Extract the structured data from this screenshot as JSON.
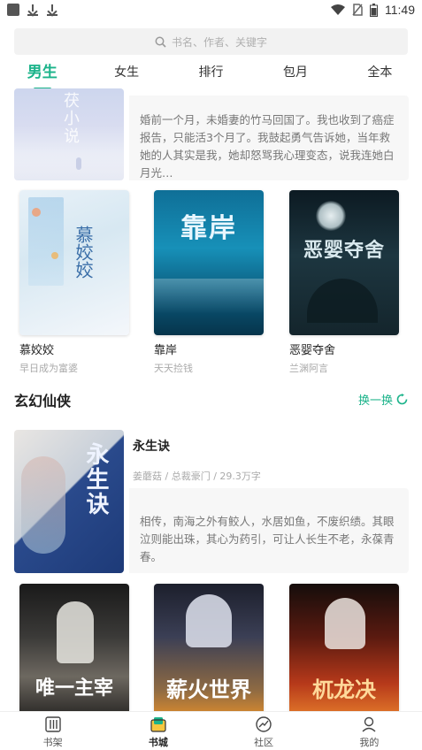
{
  "status_bar": {
    "time": "11:49"
  },
  "search": {
    "placeholder": "书名、作者、关键字"
  },
  "tabs": [
    {
      "label": "男生",
      "active": true
    },
    {
      "label": "女生",
      "active": false
    },
    {
      "label": "排行",
      "active": false
    },
    {
      "label": "包月",
      "active": false
    },
    {
      "label": "全本",
      "active": false
    }
  ],
  "featured_top": {
    "cover_text": "茯小说",
    "description": "婚前一个月，未婚妻的竹马回国了。我也收到了癌症报告，只能活3个月了。我鼓起勇气告诉她，当年救她的人其实是我，她却怒骂我心理变态，说我连她白月光…"
  },
  "row1": [
    {
      "title": "慕姣姣",
      "author": "早日成为富婆",
      "cover_text": "慕姣姣"
    },
    {
      "title": "靠岸",
      "author": "天天捡钱",
      "cover_text": "靠岸"
    },
    {
      "title": "恶婴夺舍",
      "author": "兰渊阿言",
      "cover_text": "恶婴夺舍"
    }
  ],
  "section": {
    "title": "玄幻仙侠",
    "more_label": "换一换"
  },
  "featured_fantasy": {
    "title": "永生诀",
    "meta": "姜蘑菇 / 总裁豪门 / 29.3万字",
    "cover_text": "永生诀",
    "description": "相传，南海之外有鲛人，水居如鱼，不废织绩。其眼泣则能出珠，其心为药引，可让人长生不老，永葆青春。"
  },
  "row2": [
    {
      "cover_text": "唯一主宰"
    },
    {
      "cover_text": "薪火世界"
    },
    {
      "cover_text": "杌龙决"
    }
  ],
  "bottom_nav": [
    {
      "label": "书架",
      "icon": "bookshelf-icon",
      "active": false
    },
    {
      "label": "书城",
      "icon": "bookstore-icon",
      "active": true
    },
    {
      "label": "社区",
      "icon": "community-icon",
      "active": false
    },
    {
      "label": "我的",
      "icon": "profile-icon",
      "active": false
    }
  ],
  "colors": {
    "accent": "#1bb38a",
    "text": "#222222",
    "muted": "#aaaaaa"
  }
}
